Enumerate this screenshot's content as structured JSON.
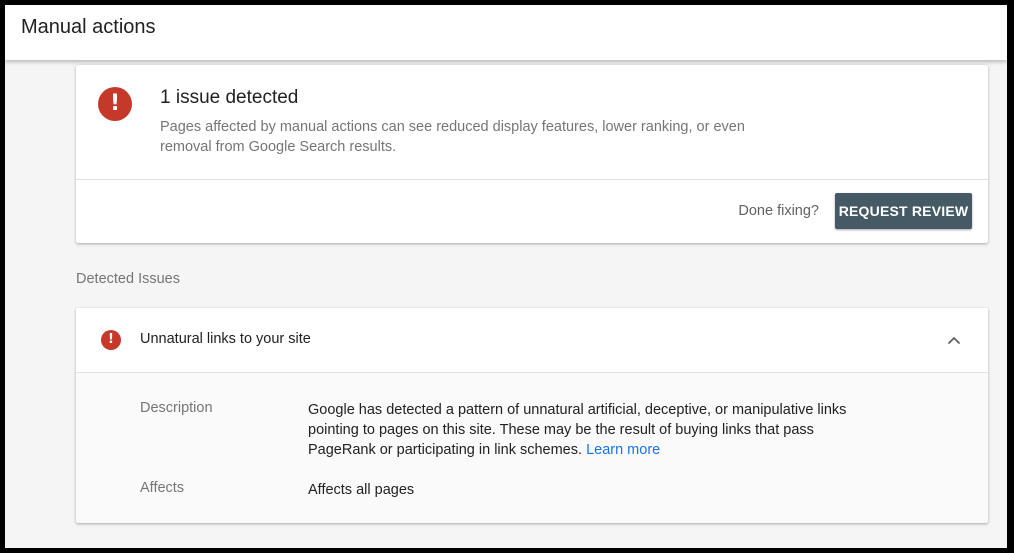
{
  "header": {
    "title": "Manual actions"
  },
  "summary": {
    "title": "1 issue detected",
    "description": "Pages affected by manual actions can see reduced display features, lower ranking, or even removal from Google Search results.",
    "done_fixing_label": "Done fixing?",
    "request_review_label": "REQUEST REVIEW",
    "icon": "error-icon"
  },
  "detected_issues": {
    "section_label": "Detected Issues",
    "items": [
      {
        "title": "Unnatural links to your site",
        "icon": "error-icon",
        "expanded": true,
        "description_label": "Description",
        "description_text": "Google has detected a pattern of unnatural artificial, deceptive, or manipulative links pointing to pages on this site. These may be the result of buying links that pass PageRank or participating in link schemes.",
        "learn_more_label": "Learn more",
        "affects_label": "Affects",
        "affects_value": "Affects all pages"
      }
    ]
  },
  "colors": {
    "error_red": "#c5392a",
    "button_bg": "#455a64",
    "link_blue": "#1a73e8",
    "page_bg": "#f5f5f5"
  }
}
